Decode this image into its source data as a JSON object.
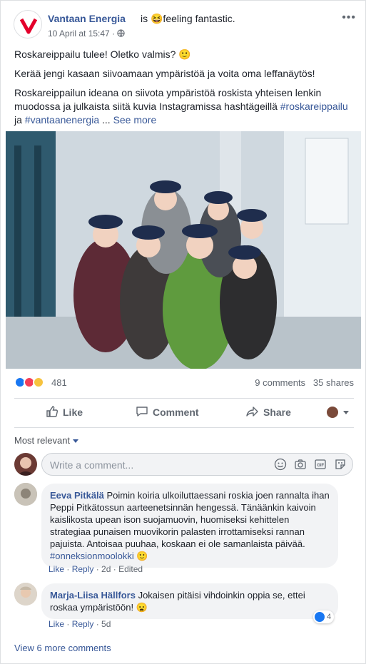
{
  "post": {
    "page_name": "Vantaan Energia",
    "feeling": "is 😆feeling fantastic.",
    "timestamp": "10 April at 15:47 ·",
    "paragraphs": [
      "Roskareippailu tulee! Oletko valmis? 🙂",
      "Kerää jengi kasaan siivoamaan ympäristöä ja voita oma leffanäytös!"
    ],
    "para3": "Roskareippailun ideana on siivota ympäristöä roskista yhteisen lenkin muodossa ja julkaista siitä kuvia Instagramissa hashtägeillä",
    "tag1": "#roskareippailu",
    "joiner": "ja",
    "tag2": "#vantaanenergia",
    "ellipsis": "...",
    "see_more": "See more"
  },
  "stats": {
    "reactions": "481",
    "comments": "9 comments",
    "shares": "35 shares"
  },
  "actions": {
    "like": "Like",
    "comment": "Comment",
    "share": "Share"
  },
  "comments_section": {
    "sort_label": "Most relevant",
    "write_placeholder": "Write a comment...",
    "view_more": "View 6 more comments"
  },
  "comments": [
    {
      "author": "Eeva Pitkälä",
      "text": "Poimin koiria ulkoiluttaessani roskia joen rannalta ihan Peppi Pitkätossun aarteenetsinnän hengessä. Tänäänkin kaivoin kaislikosta upean ison suojamuovin, huomiseksi kehittelen strategiaa punaisen muovikorin palasten irrottamiseksi rannan pajuista. Antoisaa puuhaa, koskaan ei ole samanlaista päivää.",
      "tag": "#onneksionmoolokki",
      "emoji": "🙂",
      "like": "Like",
      "reply": "Reply",
      "time": "2d",
      "edited": "Edited"
    },
    {
      "author": "Marja-Liisa Hällfors",
      "text": "Jokaisen pitäisi vihdoinkin oppia se, ettei roskaa ympäristöön!",
      "emoji": "😦",
      "like": "Like",
      "reply": "Reply",
      "time": "5d",
      "like_count": "4"
    }
  ],
  "colors": {
    "link": "#385898",
    "like_blue": "#1877f2",
    "love_red": "#f33e58",
    "wow_yellow": "#f7c33e",
    "brand_red": "#e4002b"
  }
}
